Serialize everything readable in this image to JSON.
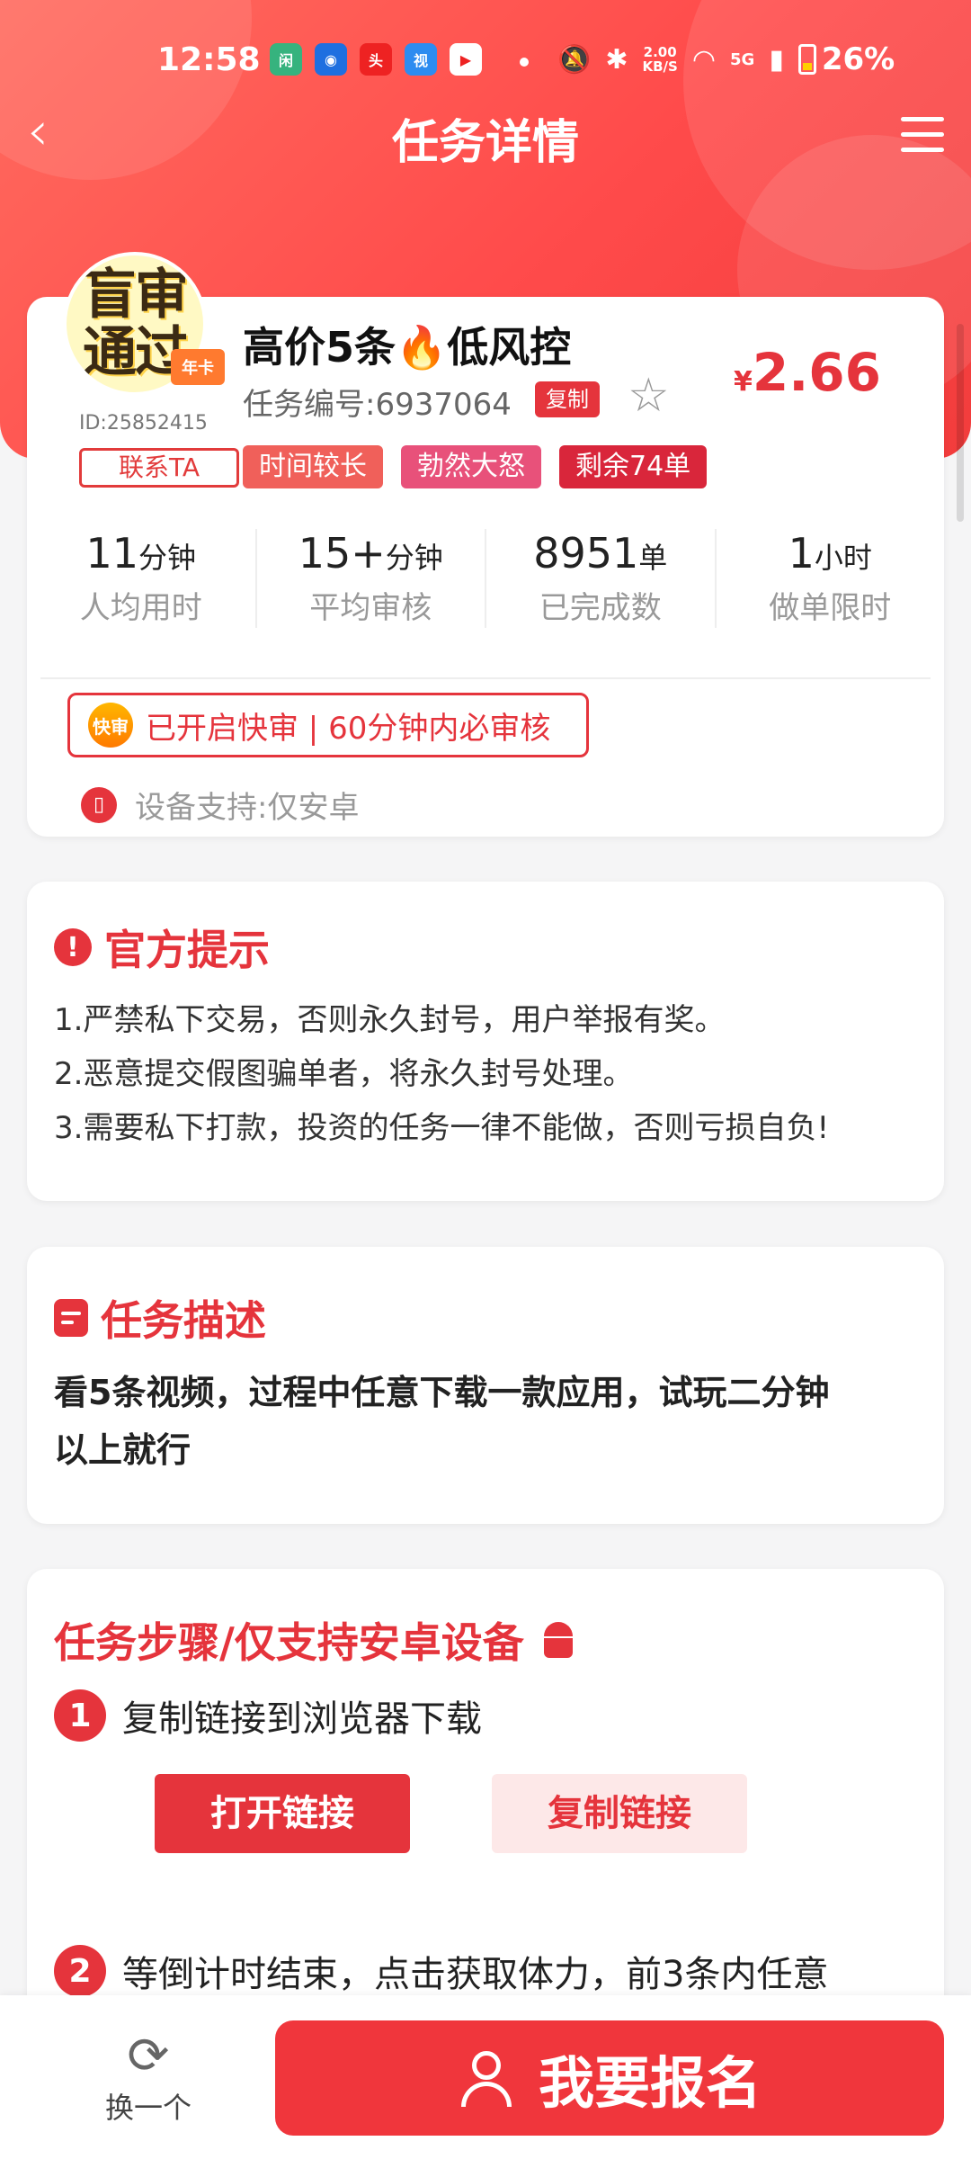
{
  "status_bar": {
    "time": "12:58",
    "net_speed_top": "2.00",
    "net_speed_bottom": "KB/S",
    "signal": "5G",
    "battery": "26%"
  },
  "nav": {
    "title": "任务详情"
  },
  "task": {
    "avatar_text": "盲审\n通过",
    "crown_label": "年卡",
    "user_id": "ID:25852415",
    "contact_label": "联系TA",
    "title": "高价5条🔥低风控",
    "task_no": "任务编号:6937064",
    "copy_label": "复制",
    "price_currency": "¥",
    "price_value": "2.66",
    "tags": [
      {
        "label": "时间较长",
        "color": "#f0605a"
      },
      {
        "label": "勃然大怒",
        "color": "#e8517a"
      },
      {
        "label": "剩余74单",
        "color": "#d9263b"
      }
    ],
    "stats": [
      {
        "value": "11",
        "unit": "分钟",
        "label": "人均用时"
      },
      {
        "value": "15+",
        "unit": "分钟",
        "label": "平均审核"
      },
      {
        "value": "8951",
        "unit": "单",
        "label": "已完成数"
      },
      {
        "value": "1",
        "unit": "小时",
        "label": "做单限时"
      }
    ],
    "fast_icon": "快审",
    "fast_text": "已开启快审 | 60分钟内必审核",
    "device_text": "设备支持:仅安卓"
  },
  "notice": {
    "title": "官方提示",
    "lines": [
      "1.严禁私下交易，否则永久封号，用户举报有奖。",
      "2.恶意提交假图骗单者，将永久封号处理。",
      "3.需要私下打款，投资的任务一律不能做，否则亏损自负!"
    ]
  },
  "description": {
    "title": "任务描述",
    "line1": "看5条视频，过程中任意下载一款应用，试玩二分钟",
    "line2": "以上就行"
  },
  "steps": {
    "title": "任务步骤/仅支持安卓设备",
    "step1_num": "1",
    "step1_text": "复制链接到浏览器下载",
    "open_link": "打开链接",
    "copy_link": "复制链接",
    "step2_num": "2",
    "step2_text": "等倒计时结束，点击获取体力，前3条内任意"
  },
  "bottom": {
    "switch_label": "换一个",
    "signup_label": "我要报名"
  },
  "colors": {
    "accent": "#e5343c",
    "header": "#ff4b4b"
  }
}
